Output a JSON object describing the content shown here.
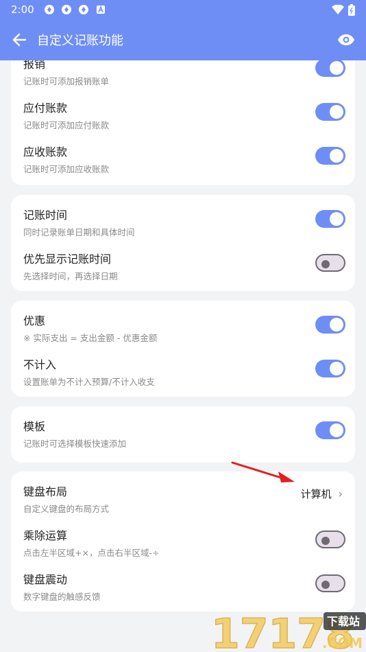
{
  "status_bar": {
    "time": "2:00"
  },
  "app_bar": {
    "title": "自定义记账功能"
  },
  "cards": [
    {
      "rows": [
        {
          "label": "报销",
          "desc": "记账时可添加报销账单",
          "toggle": true
        },
        {
          "label": "应付账款",
          "desc": "记账时可添加应付账款",
          "toggle": true
        },
        {
          "label": "应收账款",
          "desc": "记账时可添加应收账款",
          "toggle": true
        }
      ]
    },
    {
      "rows": [
        {
          "label": "记账时间",
          "desc": "同时记录账单日期和具体时间",
          "toggle": true
        },
        {
          "label": "优先显示记账时间",
          "desc": "先选择时间，再选择日期",
          "toggle": false
        }
      ]
    },
    {
      "rows": [
        {
          "label": "优惠",
          "desc": "※ 实际支出 = 支出金额 - 优惠金额",
          "toggle": true
        },
        {
          "label": "不计入",
          "desc": "设置账单为不计入预算/不计入收支",
          "toggle": true
        }
      ]
    },
    {
      "rows": [
        {
          "label": "模板",
          "desc": "记账时可选择模板快速添加",
          "toggle": true
        }
      ]
    },
    {
      "rows": [
        {
          "label": "键盘布局",
          "desc": "自定义键盘的布局方式",
          "value": "计算机"
        },
        {
          "label": "乘除运算",
          "desc": "点击左半区域+×，点击右半区域-÷",
          "toggle": false
        },
        {
          "label": "键盘震动",
          "desc": "数字键盘的触感反馈",
          "toggle": false
        }
      ]
    }
  ],
  "watermark": {
    "brand": "17178",
    "tag": "下载站",
    "domain": ".COM"
  },
  "colors": {
    "primary": "#6f8ef5",
    "arrow": "#e02020"
  }
}
